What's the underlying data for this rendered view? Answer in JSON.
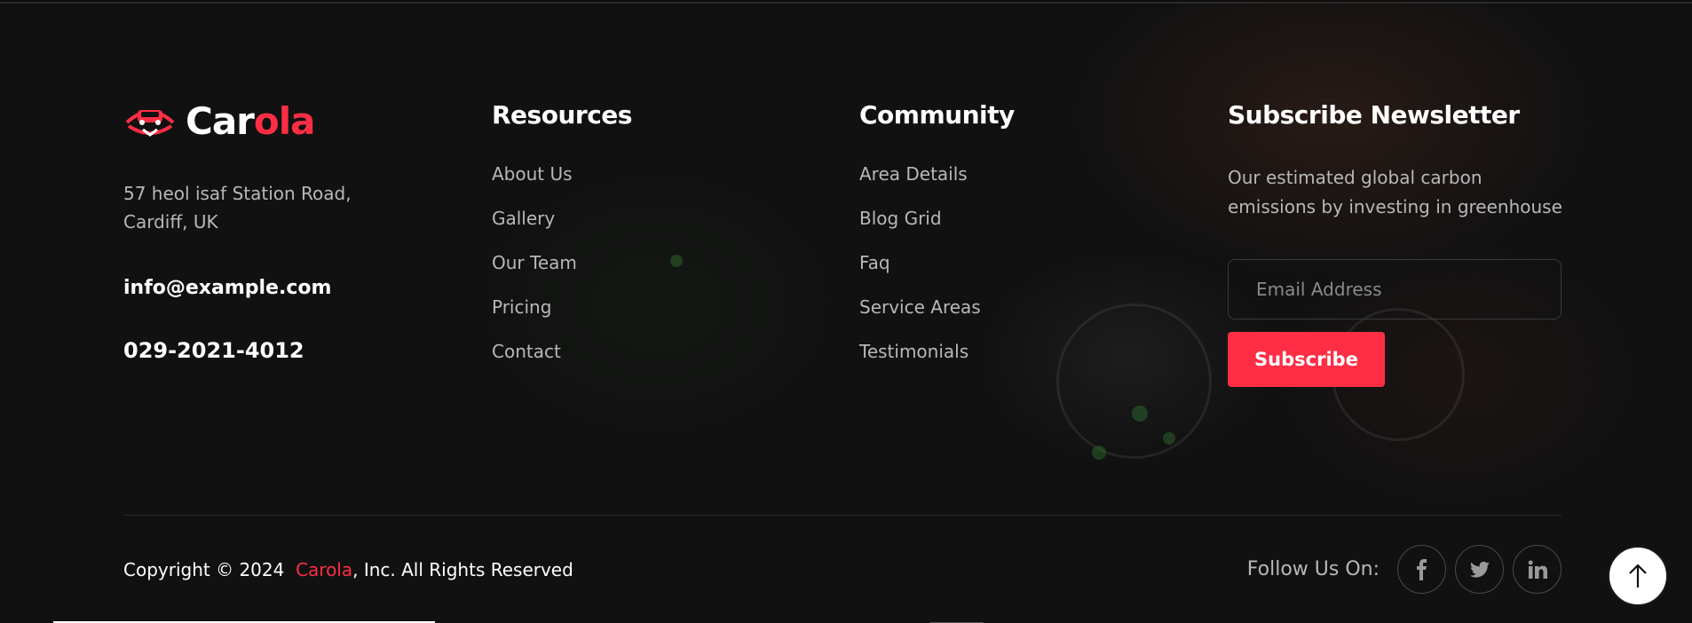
{
  "brand": {
    "logo_part1": "Car",
    "logo_part2": "ola",
    "address": "57 heol isaf Station Road, Cardiff, UK",
    "email": "info@example.com",
    "phone": "029-2021-4012",
    "accent_color": "#ff2e44"
  },
  "resources": {
    "heading": "Resources",
    "links": [
      "About Us",
      "Gallery",
      "Our Team",
      "Pricing",
      "Contact"
    ]
  },
  "community": {
    "heading": "Community",
    "links": [
      "Area Details",
      "Blog Grid",
      "Faq",
      "Service Areas",
      "Testimonials"
    ]
  },
  "newsletter": {
    "heading": "Subscribe Newsletter",
    "text": "Our estimated global carbon emissions by investing in greenhouse",
    "email_placeholder": "Email Address",
    "button_label": "Subscribe"
  },
  "bottom": {
    "copyright_prefix": "Copyright © 2024",
    "copyright_brand": "Carola",
    "copyright_suffix": ", Inc. All Rights Reserved",
    "follow_label": "Follow Us On:",
    "social_icons": [
      "facebook-icon",
      "twitter-icon",
      "linkedin-icon"
    ]
  }
}
